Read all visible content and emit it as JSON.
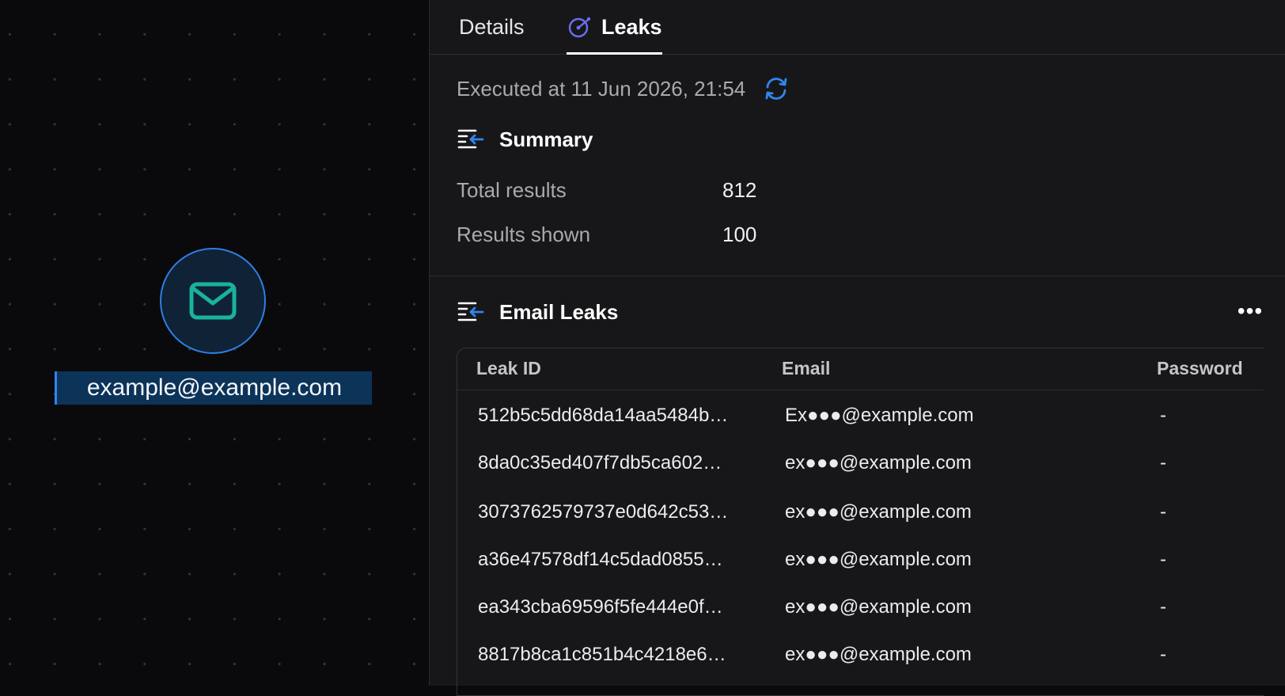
{
  "canvas": {
    "node": {
      "icon": "mail-icon",
      "label": "example@example.com"
    }
  },
  "tabs": [
    {
      "label": "Details",
      "active": false
    },
    {
      "label": "Leaks",
      "active": true,
      "icon": "radar-icon"
    }
  ],
  "execution": {
    "text": "Executed at 11 Jun 2026, 21:54",
    "refresh_icon": "refresh-icon"
  },
  "summary": {
    "title": "Summary",
    "icon": "list-collapse-icon",
    "rows": [
      {
        "label": "Total results",
        "value": "812"
      },
      {
        "label": "Results shown",
        "value": "100"
      }
    ]
  },
  "email_leaks": {
    "title": "Email Leaks",
    "icon": "list-collapse-icon",
    "more_label": "•••",
    "columns": [
      "Leak ID",
      "Email",
      "Password"
    ],
    "rows": [
      {
        "id": "512b5c5dd68da14aa5484b…",
        "email": "Ex●●●@example.com",
        "password": "-"
      },
      {
        "id": "8da0c35ed407f7db5ca602…",
        "email": "ex●●●@example.com",
        "password": "-"
      },
      {
        "id": "3073762579737e0d642c53…",
        "email": "ex●●●@example.com",
        "password": "-"
      },
      {
        "id": "a36e47578df14c5dad0855…",
        "email": "ex●●●@example.com",
        "password": "-"
      },
      {
        "id": "ea343cba69596f5fe444e0f…",
        "email": "ex●●●@example.com",
        "password": "-"
      },
      {
        "id": "8817b8ca1c851b4c4218e6…",
        "email": "ex●●●@example.com",
        "password": "-"
      }
    ]
  },
  "colors": {
    "accent": "#2f86f0",
    "node_icon": "#19b39b",
    "panel_bg": "#17171a",
    "canvas_bg": "#0a0a0c"
  }
}
